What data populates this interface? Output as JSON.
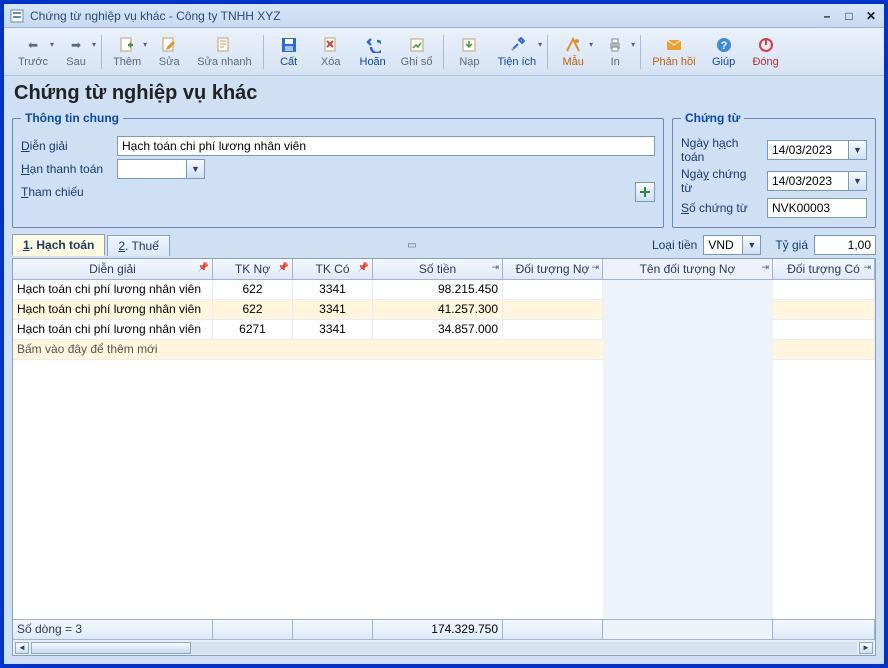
{
  "window_title": "Chứng từ nghiệp vụ khác - Công ty TNHH XYZ",
  "page_title": "Chứng từ nghiệp vụ khác",
  "toolbar": {
    "prev": "Trước",
    "next": "Sau",
    "add": "Thêm",
    "edit": "Sửa",
    "quickedit": "Sửa nhanh",
    "cut": "Cất",
    "delete": "Xóa",
    "undo": "Hoãn",
    "post": "Ghi sổ",
    "load": "Nạp",
    "util": "Tiện ích",
    "template": "Mẫu",
    "print": "In",
    "feedback": "Phản hồi",
    "help": "Giúp",
    "close": "Đóng"
  },
  "section_general": "Thông tin chung",
  "section_voucher": "Chứng từ",
  "labels": {
    "dien_giai": "Diễn giải",
    "han_tt": "Hạn thanh toán",
    "tham_chieu": "Tham chiếu",
    "ngay_ht": "Ngày hạch toán",
    "ngay_ct": "Ngày chứng từ",
    "so_ct": "Số chứng từ",
    "loai_tien": "Loại tiền",
    "ty_gia": "Tỷ giá"
  },
  "form": {
    "dien_giai": "Hạch toán chi phí lương nhân viên",
    "han_tt": "",
    "ngay_ht": "14/03/2023",
    "ngay_ct": "14/03/2023",
    "so_ct": "NVK00003",
    "loai_tien": "VND",
    "ty_gia": "1,00"
  },
  "tabs": {
    "hachtoan": "Hạch toán",
    "thue": "Thuế",
    "i1": "1",
    "i2": "2"
  },
  "columns": {
    "dien_giai": "Diễn giải",
    "tk_no": "TK Nợ",
    "tk_co": "TK Có",
    "so_tien": "Số tiền",
    "dt_no": "Đối tượng Nợ",
    "ten_dt_no": "Tên đối tượng Nợ",
    "dt_co": "Đối tượng Có"
  },
  "rows": [
    {
      "dg": "Hạch toán chi phí lương nhân viên",
      "tkn": "622",
      "tkc": "3341",
      "st": "98.215.450",
      "dtn": "",
      "tdtn": "",
      "dtc": ""
    },
    {
      "dg": "Hạch toán chi phí lương nhân viên",
      "tkn": "622",
      "tkc": "3341",
      "st": "41.257.300",
      "dtn": "",
      "tdtn": "",
      "dtc": ""
    },
    {
      "dg": "Hạch toán chi phí lương nhân viên",
      "tkn": "6271",
      "tkc": "3341",
      "st": "34.857.000",
      "dtn": "",
      "tdtn": "",
      "dtc": ""
    }
  ],
  "addnew_hint": "Bấm vào đây để thêm mới",
  "footer": {
    "rowcount": "Số dòng = 3",
    "total": "174.329.750"
  },
  "chart_data": {
    "type": "table",
    "columns": [
      "Diễn giải",
      "TK Nợ",
      "TK Có",
      "Số tiền",
      "Đối tượng Nợ",
      "Tên đối tượng Nợ",
      "Đối tượng Có"
    ],
    "rows": [
      [
        "Hạch toán chi phí lương nhân viên",
        "622",
        "3341",
        "98.215.450",
        "",
        "",
        ""
      ],
      [
        "Hạch toán chi phí lương nhân viên",
        "622",
        "3341",
        "41.257.300",
        "",
        "",
        ""
      ],
      [
        "Hạch toán chi phí lương nhân viên",
        "6271",
        "3341",
        "34.857.000",
        "",
        "",
        ""
      ]
    ],
    "total": "174.329.750"
  }
}
